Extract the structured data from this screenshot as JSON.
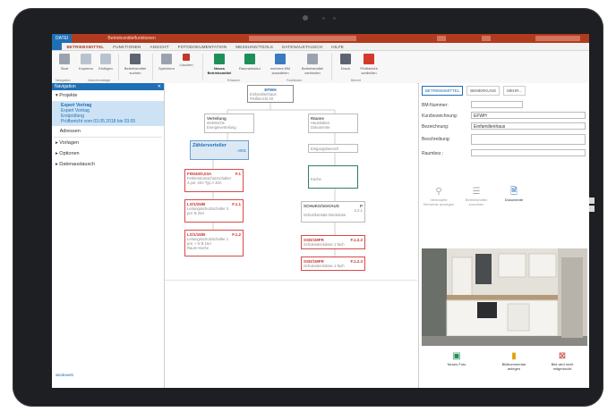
{
  "window": {
    "app_tab": "DATEI",
    "context_title": "Betriebsmittelfunktionen"
  },
  "tabs": [
    "BETRIEBSMITTEL",
    "FUNKTIONEN",
    "ANSICHT",
    "FOTODOKUMENTATION",
    "MESSUNG/TOOLS",
    "DATENAUSTAUSCH",
    "HILFE"
  ],
  "ribbon": {
    "buttons": [
      {
        "label": "Start",
        "icon": "home-icon",
        "color": "#9aa3ad"
      },
      {
        "label": "Kopieren",
        "icon": "copy-icon",
        "color": "#b8c3cf"
      },
      {
        "label": "Einfügen",
        "icon": "paste-icon",
        "color": "#b8c3cf"
      },
      {
        "label": "Betriebsmittel suchen",
        "icon": "binoculars-icon",
        "color": "#5d6670"
      },
      {
        "label": "Speichern",
        "icon": "save-icon",
        "color": "#9aa3ad"
      },
      {
        "label": "Löschen",
        "icon": "delete-icon",
        "color": "#c0392b"
      },
      {
        "label": "Neues Betriebsmittel",
        "icon": "new-document-icon",
        "color": "#1f8f5a"
      },
      {
        "label": "Raumstruktur",
        "icon": "house-icon",
        "color": "#1f8f5a"
      },
      {
        "label": "mehrere BM auswählen",
        "icon": "list-icon",
        "color": "#3a7bc0"
      },
      {
        "label": "Betriebsmittel verbinden",
        "icon": "link-icon",
        "color": "#9aa3ad"
      },
      {
        "label": "Druck",
        "icon": "print-icon",
        "color": "#5d6670"
      },
      {
        "label": "Prüfbericht schließen",
        "icon": "close-report-icon",
        "color": "#d33a2c"
      }
    ],
    "groups": [
      "Navigation",
      "Zwischenablage",
      "Erfassen",
      "Funktionen",
      "Bericht"
    ]
  },
  "nav": {
    "title": "Navigation",
    "items": [
      {
        "label": "Projekte",
        "expanded": true
      },
      {
        "label": "Adressen"
      },
      {
        "label": "Vorlagen"
      },
      {
        "label": "Optionen"
      },
      {
        "label": "Datenaustausch"
      }
    ],
    "project_entries": [
      "Expert Vortrag",
      "Expert Vortrag",
      "Erstprüfung",
      "Prüfbericht vom 03.05.2018 bis 03.05"
    ],
    "footer": "wiedeweb"
  },
  "diagram": {
    "root": {
      "title": "EFWH",
      "sub1": "Einfamilienhaus",
      "sub2": "Prüfbericht 40"
    },
    "left_top": {
      "title": "Verteilung",
      "sub1": "elektrische",
      "sub2": "Energieverteilung"
    },
    "right_top": {
      "title": "Räume",
      "sub1": "Haushalten",
      "sub2": "Dokumente"
    },
    "meter": {
      "title": "Zählerverteiler",
      "code": "A001"
    },
    "entrance": {
      "label": "Eingangsbereich"
    },
    "kitchen": {
      "label": "Küche"
    },
    "rcd": {
      "title": "FI/6/40/0,03A",
      "code": "F.1",
      "sub1": "Fehlerstromschutzschalter",
      "sub2": "4 pol. 40A Typ A 30A"
    },
    "breakers": [
      {
        "title": "LS/1/25/B",
        "code": "F.1.1",
        "sub1": "Leitungsschutzschalter 3",
        "sub2": "pol. B 25A"
      },
      {
        "title": "LS/1/16/B",
        "code": "F.1.2",
        "sub1": "Leitungsschutzschalter 1",
        "sub2": "pol. + N B 16A",
        "sub3": "Raum Küche"
      }
    ],
    "socket": {
      "title": "SCHUKO/10A/AUS",
      "code": "P",
      "sub1": "2.2.1",
      "sub2": "Schutzkontakt-Steckdose"
    },
    "outlets": [
      {
        "title": "SSD/1MFR",
        "code": "F.1.2.2",
        "sub1": "Schukosteckdose 1-fach"
      },
      {
        "title": "SSD/1MFR",
        "code": "F.1.2.3",
        "sub1": "Schukosteckdose 1-fach"
      }
    ]
  },
  "right_panel": {
    "tabs": [
      "BETRIEBSMITTEL",
      "BEMERKUNG",
      "MEHR..."
    ],
    "fields": [
      {
        "label": "BM-Nummer:",
        "value": ""
      },
      {
        "label": "Kurzbezeichnung:",
        "value": "EFWH"
      },
      {
        "label": "Bezeichnung:",
        "value": "Einfamilienhaus"
      },
      {
        "label": "Beschreibung:",
        "value": ""
      },
      {
        "label": "Raumbez.:",
        "value": ""
      }
    ],
    "actions": [
      {
        "label": "Verknüpfte Elemente anzeigen",
        "icon": "link-icon"
      },
      {
        "label": "Betriebsmittel zuordnen",
        "icon": "list-icon"
      },
      {
        "label": "Dokumente",
        "icon": "document-icon"
      }
    ],
    "photo_buttons": [
      {
        "label": "Neues Foto",
        "icon": "camera-icon",
        "color": "#1f8f5a"
      },
      {
        "label": "Bildkommentar anlegen",
        "icon": "folder-icon",
        "color": "#e0a100"
      },
      {
        "label": "Bild wird nicht mitgedruckt",
        "icon": "print-off-icon",
        "color": "#c0392b"
      }
    ]
  }
}
